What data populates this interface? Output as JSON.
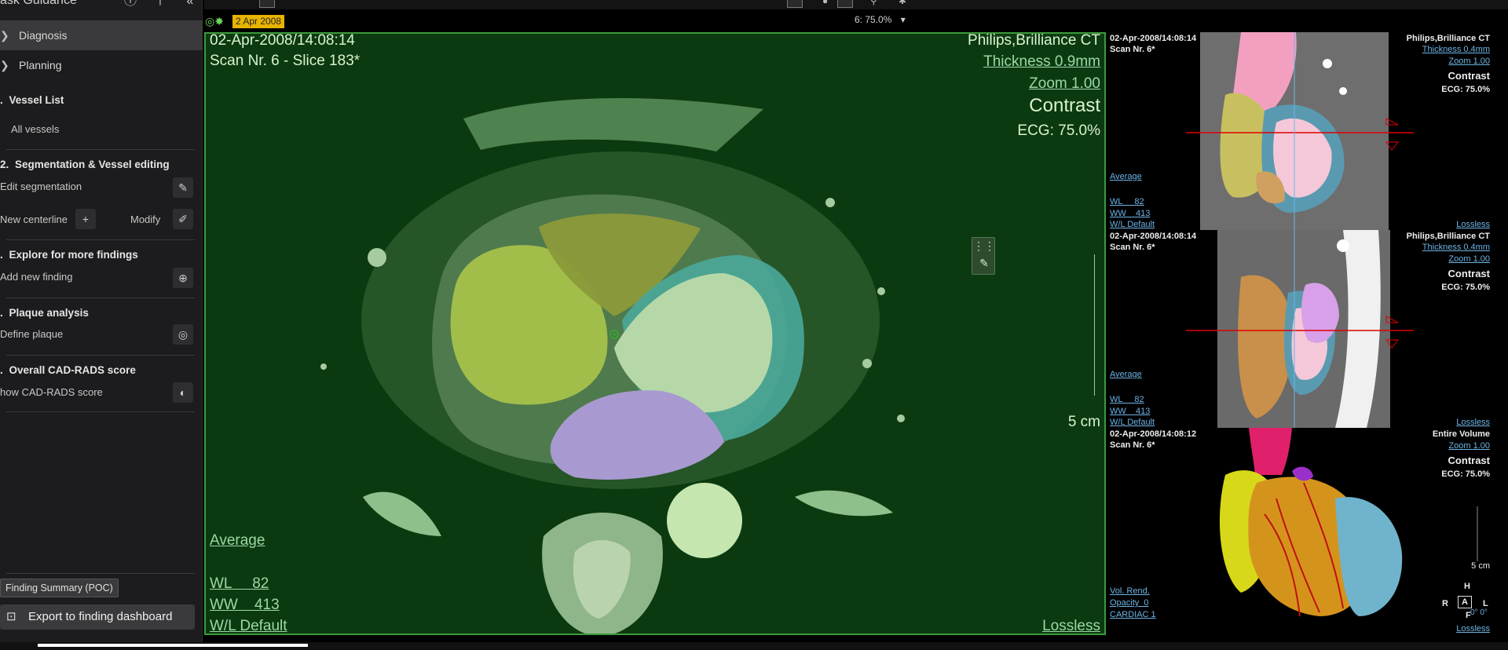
{
  "sidebar": {
    "header_title": "ask Guidance",
    "header_icons": [
      "info-icon",
      "pin-icon",
      "collapse-icon"
    ],
    "nav": [
      {
        "label": "Diagnosis",
        "icon": "diagnosis-icon",
        "active": true
      },
      {
        "label": "Planning",
        "icon": "planning-icon",
        "active": false
      }
    ],
    "sections": [
      {
        "title": "Vessel List",
        "num": "."
      },
      {
        "title": "Segmentation & Vessel editing",
        "num": "2."
      },
      {
        "title": "Explore for more findings",
        "num": "."
      },
      {
        "title": "Plaque analysis",
        "num": "."
      },
      {
        "title": "Overall CAD-RADS score",
        "num": "."
      }
    ],
    "items": {
      "all_vessels": "All vessels",
      "edit_segmentation": "Edit segmentation",
      "new_centerline": "New centerline",
      "modify": "Modify",
      "add_new_finding": "Add new finding",
      "define_plaque": "Define plaque",
      "show_cadrads": "how CAD-RADS score"
    },
    "finding_summary": "Finding Summary (POC)",
    "export_label": "Export to finding dashboard"
  },
  "toolbar": {
    "zoom_value": "6: 75.0%"
  },
  "main_view": {
    "date_badge": "2 Apr 2008",
    "datetime": "02-Apr-2008/14:08:14",
    "scan_slice": "Scan Nr. 6 - Slice 183*",
    "scanner": "Philips,Brilliance CT",
    "thickness": "Thickness 0.9mm",
    "zoom": "Zoom 1.00",
    "contrast": "Contrast",
    "ecg": "ECG: 75.0%",
    "scale_label": "5 cm",
    "average": "Average",
    "wl": "WL     82",
    "ww": "WW    413",
    "wl_default": "W/L Default",
    "lossless": "Lossless"
  },
  "panel1": {
    "datetime": "02-Apr-2008/14:08:14",
    "scan": "Scan Nr. 6*",
    "scanner": "Philips,Brilliance CT",
    "thickness": "Thickness 0.4mm",
    "zoom": "Zoom 1.00",
    "contrast": "Contrast",
    "ecg": "ECG: 75.0%",
    "average": "Average",
    "wl": "WL     82",
    "ww": "WW    413",
    "wl_default": "W/L Default",
    "lossless": "Lossless"
  },
  "panel2": {
    "datetime": "02-Apr-2008/14:08:14",
    "scan": "Scan Nr. 6*",
    "scanner": "Philips,Brilliance CT",
    "thickness": "Thickness 0.4mm",
    "zoom": "Zoom 1.00",
    "contrast": "Contrast",
    "ecg": "ECG: 75.0%",
    "average": "Average",
    "wl": "WL     82",
    "ww": "WW    413",
    "wl_default": "W/L Default",
    "lossless": "Lossless"
  },
  "panel3": {
    "datetime": "02-Apr-2008/14:08:12",
    "scan": "Scan Nr. 6*",
    "scope": "Entire Volume",
    "zoom": "Zoom 1.00",
    "contrast": "Contrast",
    "ecg": "ECG: 75.0%",
    "vol_rend": "Vol. Rend.",
    "opacity": "Opacity  0",
    "preset": "CARDIAC 1",
    "scale_label": "5 cm",
    "orient_h": "H",
    "orient_r": "R",
    "orient_a": "A",
    "orient_l": "L",
    "orient_f": "F",
    "angle": "0° 0°",
    "lossless": "Lossless"
  },
  "colors": {
    "main_bg": "#0c3a10",
    "main_border": "#3c9a3c",
    "overlay_text": "#b7e6a6",
    "link_blue": "#6db4e6",
    "date_badge": "#e8b400"
  }
}
